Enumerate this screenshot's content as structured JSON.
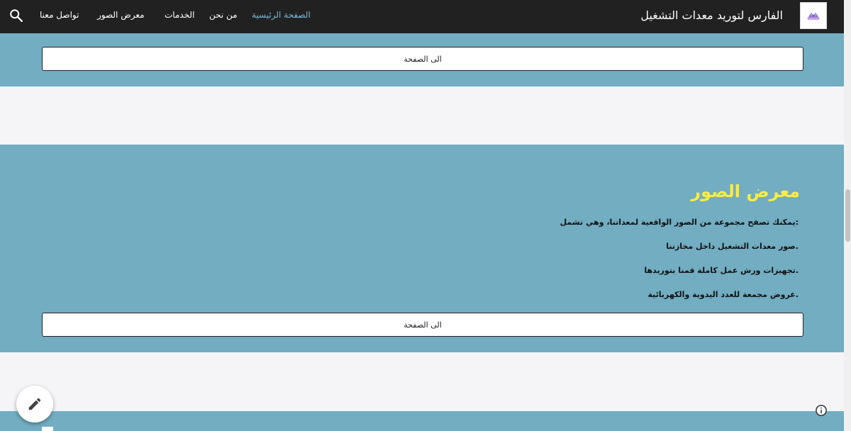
{
  "header": {
    "site_title": "الفارس لتوريد معدات التشغيل",
    "nav": [
      {
        "label": "الصفحة الرئيسية",
        "active": true
      },
      {
        "label": "من نحن",
        "active": false
      },
      {
        "label": "الخدمات",
        "active": false
      },
      {
        "label": "معرض الصور",
        "active": false
      },
      {
        "label": "تواصل معنا",
        "active": false
      }
    ],
    "logo_icon": "logo-icon",
    "search_icon": "search-icon"
  },
  "section1": {
    "button_label": "الى الصفحة"
  },
  "gallery": {
    "title": "معرض الصور",
    "lines": [
      ":يمكنك تصفح مجموعة من الصور الواقعية لمعداتنا، وهي تشمل",
      ".صور معدات التشغيل داخل مخازننا",
      ".تجهيزات ورش عمل كاملة قمنا بتوريدها",
      ".عروض مجمعة للعدد اليدوية والكهربائية"
    ],
    "button_label": "الى الصفحة"
  },
  "fab_icon": "pencil-icon",
  "info_icon": "info-icon",
  "colors": {
    "topbar": "#212121",
    "band": "#72adc1",
    "title_accent": "#ffec3d",
    "nav_active": "#7ab7d6"
  }
}
